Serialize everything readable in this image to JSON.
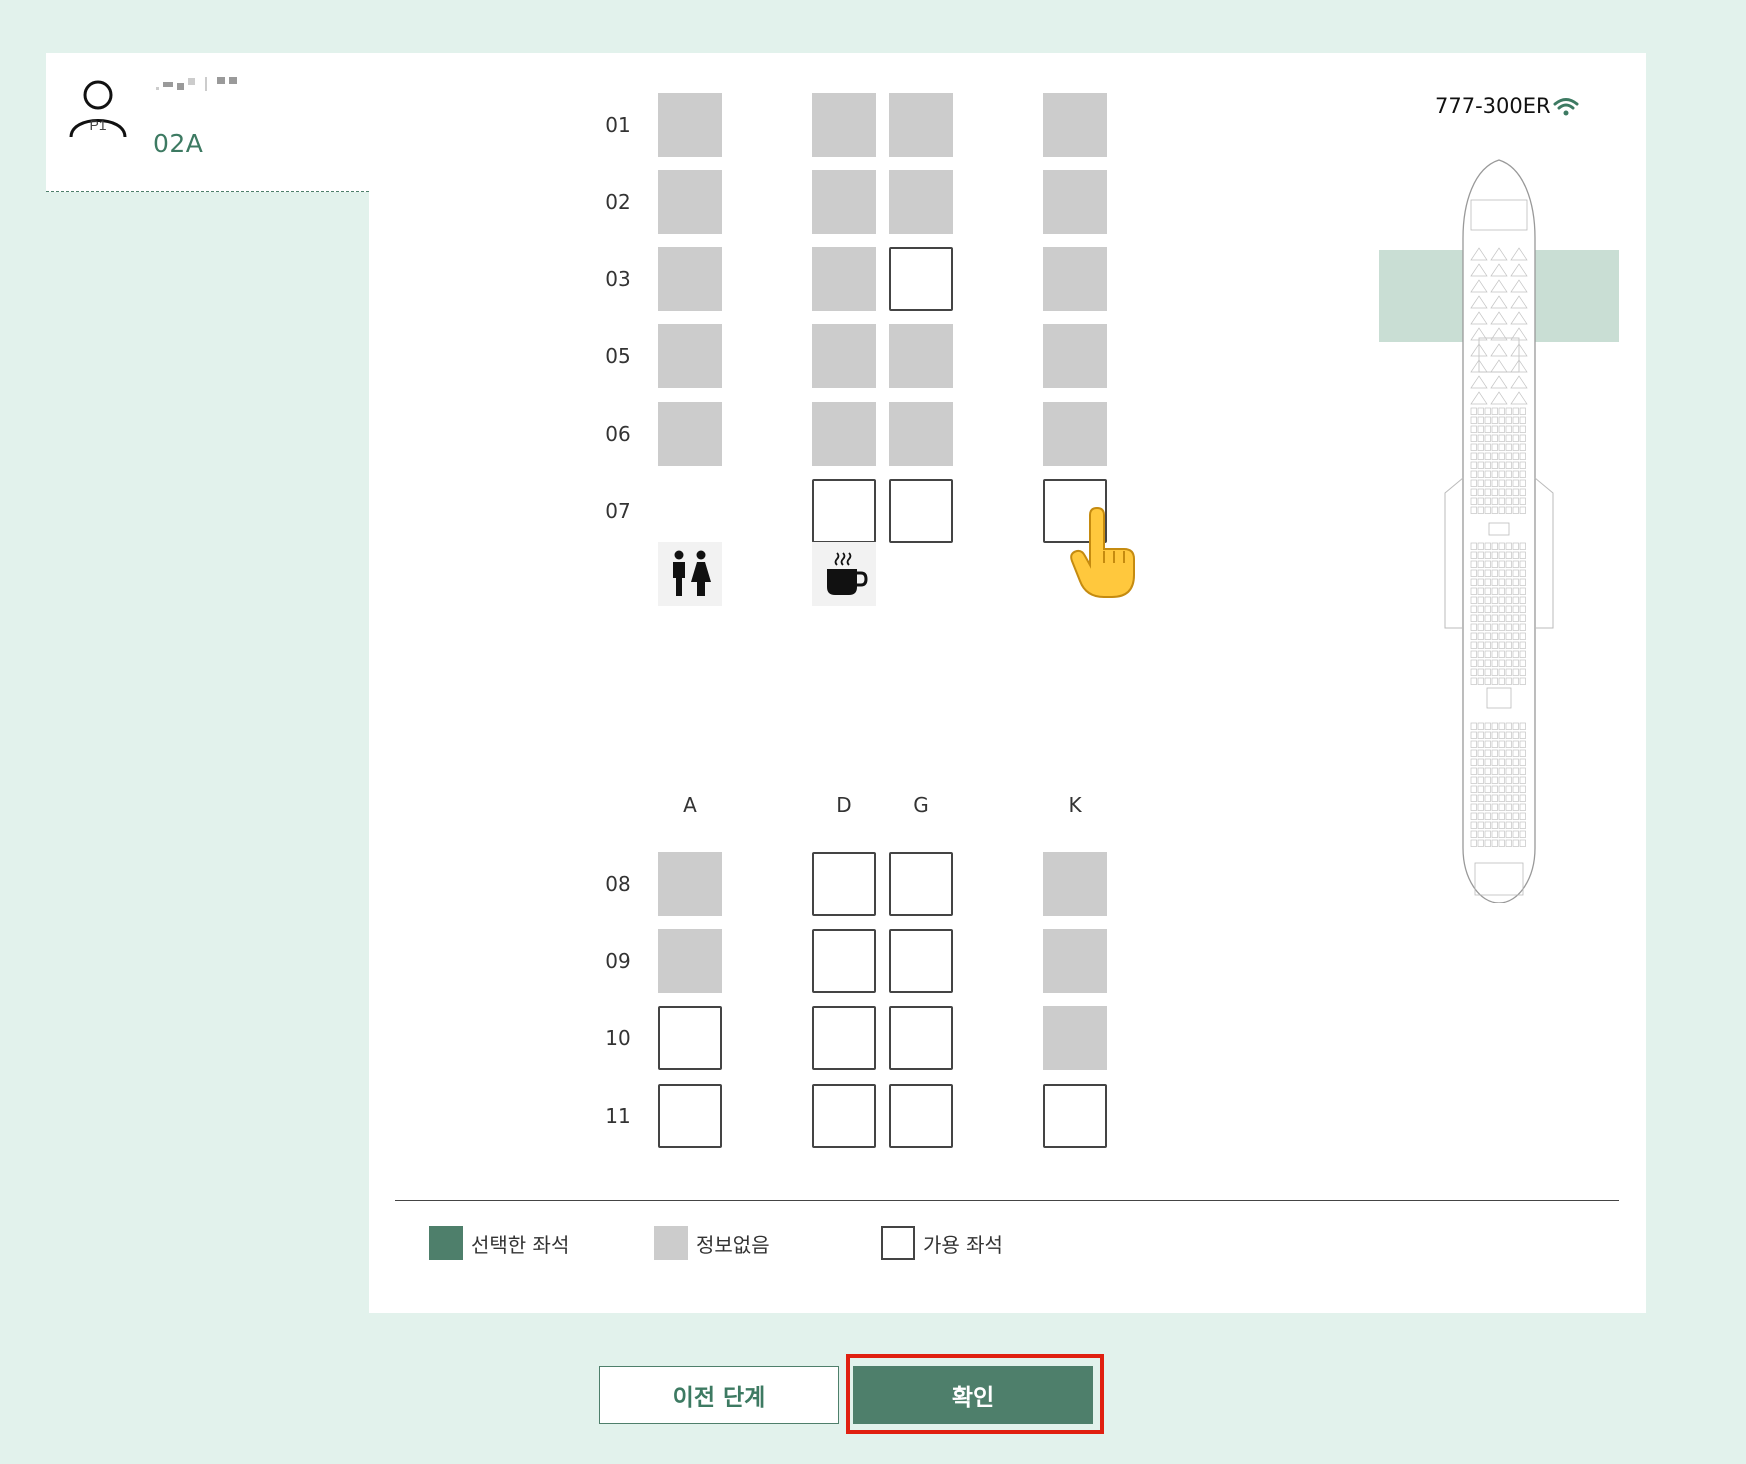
{
  "passenger": {
    "tag": "P1",
    "seat": "02A"
  },
  "aircraft": {
    "type": "777-300ER"
  },
  "seatmap": {
    "columns": [
      "A",
      "D",
      "G",
      "K"
    ],
    "rows_upper": [
      {
        "label": "01",
        "seats": {
          "A": "unavailable",
          "D": "unavailable",
          "G": "unavailable",
          "K": "unavailable"
        }
      },
      {
        "label": "02",
        "seats": {
          "A": "unavailable",
          "D": "unavailable",
          "G": "unavailable",
          "K": "unavailable"
        }
      },
      {
        "label": "03",
        "seats": {
          "A": "unavailable",
          "D": "unavailable",
          "G": "available",
          "K": "unavailable"
        }
      },
      {
        "label": "05",
        "seats": {
          "A": "unavailable",
          "D": "unavailable",
          "G": "unavailable",
          "K": "unavailable"
        }
      },
      {
        "label": "06",
        "seats": {
          "A": "unavailable",
          "D": "unavailable",
          "G": "unavailable",
          "K": "unavailable"
        }
      },
      {
        "label": "07",
        "seats": {
          "A": null,
          "D": "available",
          "G": "available",
          "K": "available"
        }
      }
    ],
    "facilities": [
      "restroom-icon",
      "galley-coffee-icon"
    ],
    "rows_lower": [
      {
        "label": "08",
        "seats": {
          "A": "unavailable",
          "D": "available",
          "G": "available",
          "K": "unavailable"
        }
      },
      {
        "label": "09",
        "seats": {
          "A": "unavailable",
          "D": "available",
          "G": "available",
          "K": "unavailable"
        }
      },
      {
        "label": "10",
        "seats": {
          "A": "available",
          "D": "available",
          "G": "available",
          "K": "unavailable"
        }
      },
      {
        "label": "11",
        "seats": {
          "A": "available",
          "D": "available",
          "G": "available",
          "K": "available"
        }
      }
    ]
  },
  "legend": {
    "selected": "선택한 좌석",
    "unavailable": "정보없음",
    "available": "가용 좌석"
  },
  "buttons": {
    "prev": "이전 단계",
    "confirm": "확인"
  },
  "colors": {
    "background": "#e2f2ec",
    "accent": "#4e7f6b",
    "unavailable": "#cccccc",
    "highlight": "#e02010"
  }
}
